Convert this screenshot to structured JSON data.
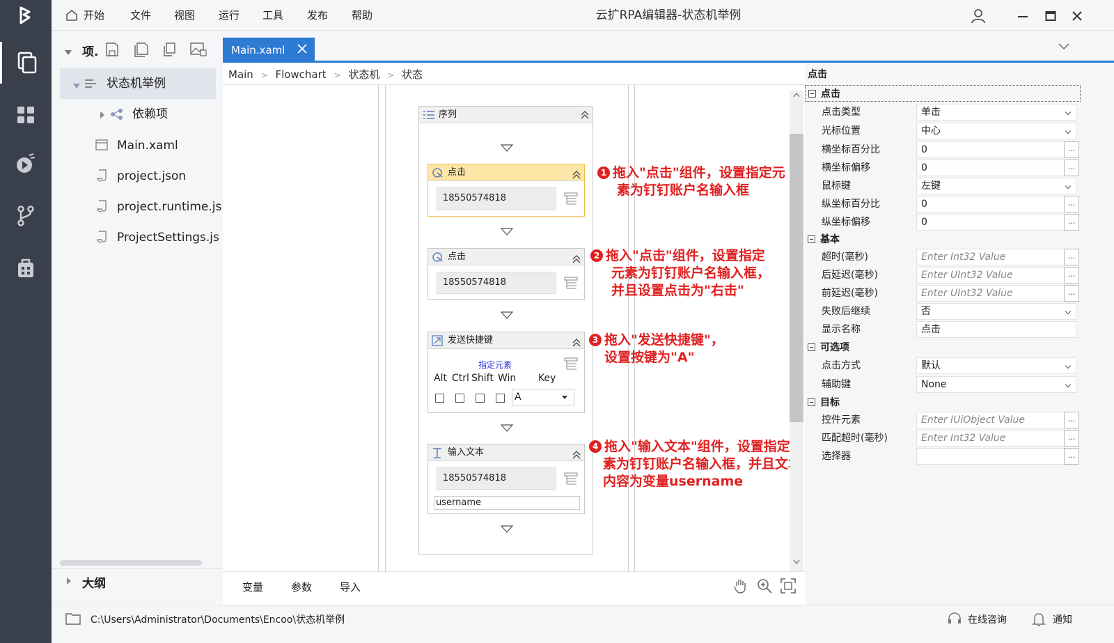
{
  "window": {
    "title": "云扩RPA编辑器-状态机举例"
  },
  "menu": {
    "home": "开始",
    "items": [
      "文件",
      "视图",
      "运行",
      "工具",
      "发布",
      "帮助"
    ]
  },
  "project": {
    "header": "项.",
    "root": "状态机举例",
    "deps": "依赖项",
    "files": [
      "Main.xaml",
      "project.json",
      "project.runtime.js",
      "ProjectSettings.js"
    ],
    "outline": "大纲"
  },
  "tabs": [
    {
      "label": "Main.xaml"
    }
  ],
  "breadcrumb": [
    "Main",
    "Flowchart",
    "状态机",
    "状态"
  ],
  "workflow": {
    "sequence_title": "序列",
    "click1": {
      "title": "点击",
      "target": "18550574818"
    },
    "click2": {
      "title": "点击",
      "target": "18550574818"
    },
    "hotkey": {
      "title": "发送快捷键",
      "target_label": "指定元素",
      "alt": "Alt",
      "ctrl": "Ctrl",
      "shift": "Shift",
      "win": "Win",
      "key_label": "Key",
      "key_value": "A"
    },
    "typetext": {
      "title": "输入文本",
      "target": "18550574818",
      "text": "username"
    }
  },
  "annotations": [
    {
      "num": "1",
      "line1": "拖入\"点击\"组件，设置指定元",
      "line2": "素为钉钉账户名输入框",
      "line3": ""
    },
    {
      "num": "2",
      "line1": "拖入\"点击\"组件，设置指定",
      "line2": "元素为钉钉账户名输入框，",
      "line3": "并且设置点击为\"右击\""
    },
    {
      "num": "3",
      "line1": "拖入\"发送快捷键\"，",
      "line2": "设置按键为\"A\"",
      "line3": ""
    },
    {
      "num": "4",
      "line1": "拖入\"输入文本\"组件，设置指定元",
      "line2": "素为钉钉账户名输入框，并且文本",
      "line3": "内容为变量username"
    }
  ],
  "bottom_tabs": [
    "变量",
    "参数",
    "导入"
  ],
  "properties": {
    "title": "点击",
    "cat_click": "点击",
    "click_type": {
      "name": "点击类型",
      "value": "单击"
    },
    "cursor_pos": {
      "name": "光标位置",
      "value": "中心"
    },
    "x_pct": {
      "name": "横坐标百分比",
      "value": "0"
    },
    "x_off": {
      "name": "横坐标偏移",
      "value": "0"
    },
    "mouse_btn": {
      "name": "鼠标键",
      "value": "左键"
    },
    "y_pct": {
      "name": "纵坐标百分比",
      "value": "0"
    },
    "y_off": {
      "name": "纵坐标偏移",
      "value": "0"
    },
    "cat_basic": "基本",
    "timeout": {
      "name": "超时(毫秒)",
      "placeholder": "Enter Int32 Value"
    },
    "delay_after": {
      "name": "后延迟(毫秒)",
      "placeholder": "Enter UInt32 Value"
    },
    "delay_before": {
      "name": "前延迟(毫秒)",
      "placeholder": "Enter UInt32 Value"
    },
    "continue_on_error": {
      "name": "失败后继续",
      "value": "否"
    },
    "display_name": {
      "name": "显示名称",
      "value": "点击"
    },
    "cat_optional": "可选项",
    "click_method": {
      "name": "点击方式",
      "value": "默认"
    },
    "modifier": {
      "name": "辅助键",
      "value": "None"
    },
    "cat_target": "目标",
    "control": {
      "name": "控件元素",
      "placeholder": "Enter IUiObject Value"
    },
    "match_timeout": {
      "name": "匹配超时(毫秒)",
      "placeholder": "Enter Int32 Value"
    },
    "selector": {
      "name": "选择器",
      "value": ""
    }
  },
  "status": {
    "path": "C:\\Users\\Administrator\\Documents\\Encoo\\状态机举例",
    "consult": "在线咨询",
    "notify": "通知"
  },
  "colors": {
    "sidebar": "#3a3f4c",
    "accent": "#2e7bd4",
    "annotation": "#e02020",
    "selected_activity": "#fde6a6"
  }
}
